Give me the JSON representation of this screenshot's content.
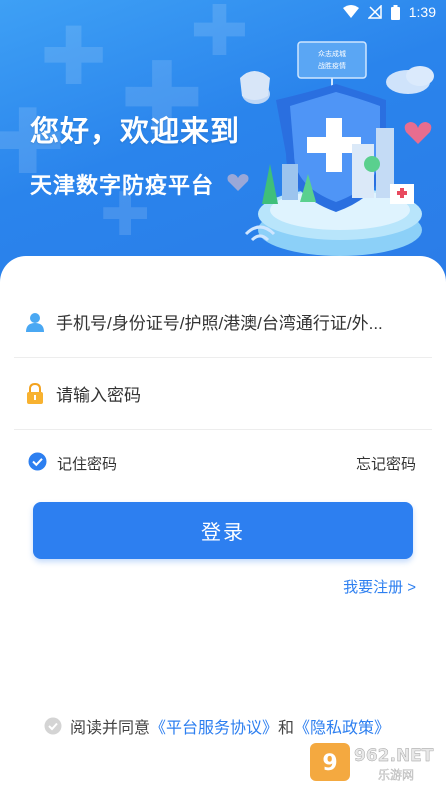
{
  "status_bar": {
    "time": "1:39"
  },
  "banner": {
    "greeting": "您好，欢迎来到",
    "platform_name": "天津数字防疫平台",
    "sign_lines": [
      "众志成城",
      "战胜疫情"
    ]
  },
  "login": {
    "account_placeholder": "手机号/身份证号/护照/港澳/台湾通行证/外...",
    "password_placeholder": "请输入密码",
    "remember_label": "记住密码",
    "remember_checked": true,
    "forgot_label": "忘记密码",
    "login_button": "登录",
    "register_link": "我要注册 >"
  },
  "agreement": {
    "prefix": "阅读并同意",
    "service_link": "《平台服务协议》",
    "conjunction": "和",
    "privacy_link": "《隐私政策》"
  },
  "watermark": {
    "brand": "962.NET",
    "sub": "乐游网"
  },
  "colors": {
    "primary": "#2d7ff0",
    "banner": "#2a84ec"
  }
}
